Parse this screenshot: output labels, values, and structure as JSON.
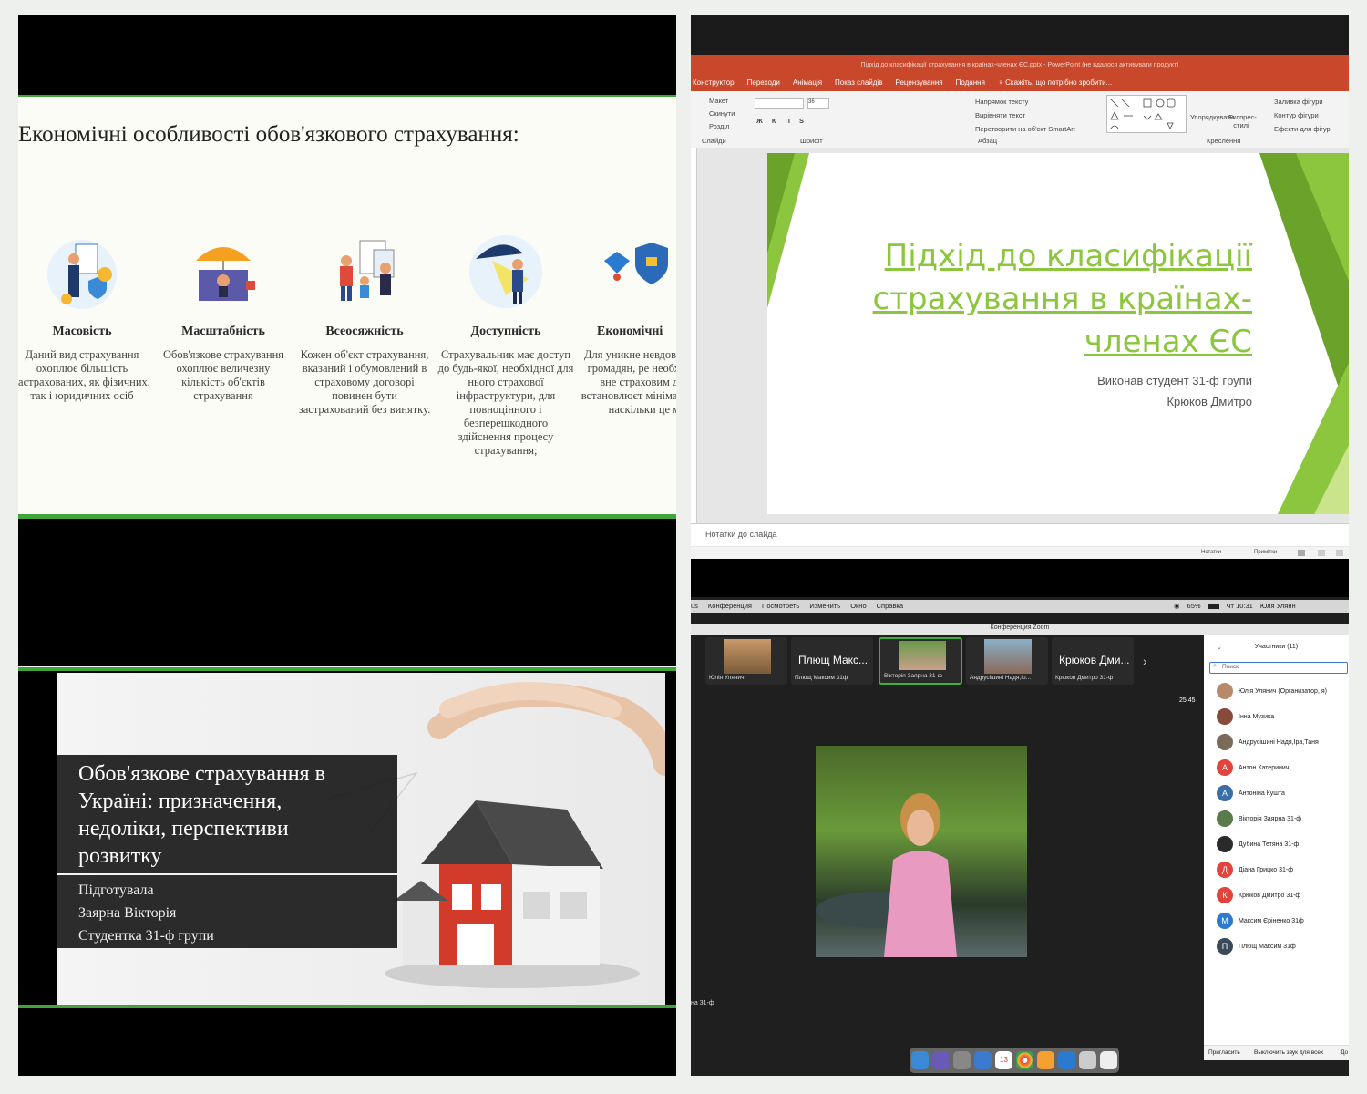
{
  "panel1": {
    "title": "Економічні особливості обов'язкового страхування:",
    "features": [
      {
        "title": "Масовість",
        "desc": "Даний вид страхування охоплює більшість застрахованих, як фізичних, так і юридичних осіб"
      },
      {
        "title": "Масштабність",
        "desc": "Обов'язкове страхування охоплює величезну кількість об'єктів страхування"
      },
      {
        "title": "Всеосяжність",
        "desc": "Кожен об'єкт страхування, вказаний і обумовлений в страховому договорі повинен бути застрахований без винятку."
      },
      {
        "title": "Доступність",
        "desc": "Страхувальник має доступ до будь-якої, необхідної для нього страхової інфраструктури, для повноцінного і безперешкодного здійснення процесу страхування;"
      },
      {
        "title": "Економічні",
        "desc": "Для уникне невдоволення громадян, ре необхідних вне страховим дого встановлюєт мінімальному наскільки це мо"
      }
    ]
  },
  "panel2": {
    "window_title": "Підхід до класифікації страхування в країнах-членах ЄС.pptx - PowerPoint (не вдалося активувати продукт)",
    "menu": [
      "Конструктор",
      "Переходи",
      "Анімація",
      "Показ слайдів",
      "Рецензування",
      "Подання"
    ],
    "tell_me": "Скажіть, що потрібно зробити...",
    "ribbon": {
      "slides_group": [
        "Макет",
        "Скинути",
        "Розділ"
      ],
      "slides_label": "Слайди",
      "font_label": "Шрифт",
      "font_size": "36",
      "paragraph_items": [
        "Напрямок тексту",
        "Вирівняти текст",
        "Перетворити на об'єкт SmartArt"
      ],
      "paragraph_label": "Абзац",
      "arrange": "Упорядкувати",
      "quick_styles": "Експрес-стилі",
      "drawing_items": [
        "Заливка фігури",
        "Контур фігури",
        "Ефекти для фігур"
      ],
      "drawing_label": "Креслення"
    },
    "slide_title": "Підхід до класифікації страхування в країнах-членах ЄС",
    "slide_sub1": "Виконав студент 31-ф групи",
    "slide_sub2": "Крюков Дмитро",
    "notes": "Нотатки до слайда",
    "status_notes": "Нотатки",
    "status_comments": "Примітки"
  },
  "panel3": {
    "title": "Обов'язкове страхування в Україні: призначення, недоліки, перспективи розвитку",
    "lines": [
      "Підготувала",
      "Заярна Вікторія",
      "Студентка 31-ф групи"
    ]
  },
  "panel4": {
    "menu": [
      "Конференция",
      "Посмотреть",
      "Изменить",
      "Окно",
      "Справка"
    ],
    "menu_partial": "us",
    "battery": "65%",
    "time": "Чт 10:31",
    "user": "Юля Улянн",
    "window_title": "Конференция Zoom",
    "thumbs": [
      {
        "label": "Юлія Улянич",
        "big": ""
      },
      {
        "label": "Плющ Максим 31ф",
        "big": "Плющ Макс..."
      },
      {
        "label": "Вікторія Заярна 31-ф",
        "big": ""
      },
      {
        "label": "Андрусішині Надя,Ір...",
        "big": ""
      },
      {
        "label": "Крюков Дмитро 31-ф",
        "big": "Крюков Дми..."
      }
    ],
    "timer": "25:45",
    "speaker_partial": "на 31-ф",
    "participants_title": "Участники (11)",
    "search_placeholder": "Поиск",
    "participants": [
      {
        "name": "Юлія Улянич (Организатор, я)",
        "letter": "",
        "color": "#b98a6a"
      },
      {
        "name": "Інна Музика",
        "letter": "",
        "color": "#8a4a3a"
      },
      {
        "name": "Андрусішині Надя,Іра,Таня",
        "letter": "",
        "color": "#7a6a5a"
      },
      {
        "name": "Антон Катеринич",
        "letter": "А",
        "color": "#e0443a"
      },
      {
        "name": "Антоніна Кушта",
        "letter": "А",
        "color": "#3a6ea8"
      },
      {
        "name": "Вікторія Заярна 31-ф",
        "letter": "",
        "color": "#5a7a4a"
      },
      {
        "name": "Дубина Тетяна 31-ф",
        "letter": "",
        "color": "#2a2a2a"
      },
      {
        "name": "Діана Грицко 31-ф",
        "letter": "Д",
        "color": "#e0443a"
      },
      {
        "name": "Крюков Дмитро 31-ф",
        "letter": "К",
        "color": "#e0443a"
      },
      {
        "name": "Максим Єріненко 31ф",
        "letter": "М",
        "color": "#2a7bd0"
      },
      {
        "name": "Плющ Максим 31ф",
        "letter": "П",
        "color": "#3a4a5a"
      }
    ],
    "invite": "Пригласить",
    "mute_all": "Выключить звук для всех",
    "more": "До",
    "calendar_day": "13"
  }
}
